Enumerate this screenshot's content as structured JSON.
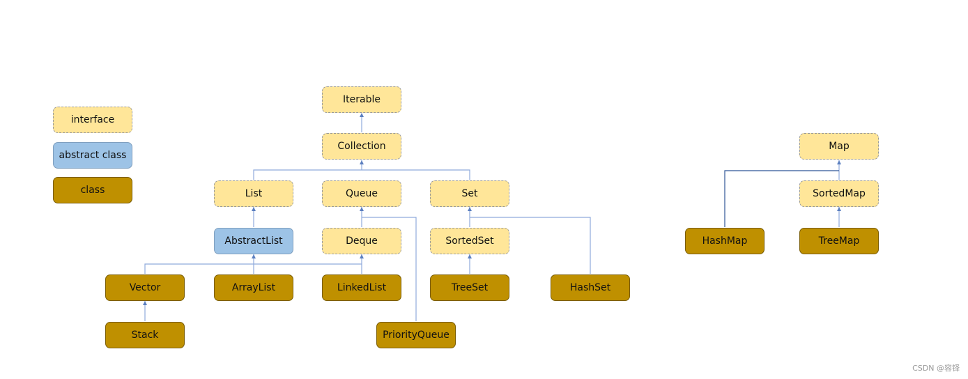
{
  "colors": {
    "interface": "#ffe699",
    "abstract_class": "#9dc3e6",
    "class": "#bf9000",
    "edge": "#5b7fbf"
  },
  "legend": {
    "interface": "interface",
    "abstract_class": "abstract class",
    "class": "class"
  },
  "nodes": {
    "iterable": "Iterable",
    "collection": "Collection",
    "list": "List",
    "queue": "Queue",
    "set": "Set",
    "abstractlist": "AbstractList",
    "deque": "Deque",
    "sortedset": "SortedSet",
    "vector": "Vector",
    "arraylist": "ArrayList",
    "linkedlist": "LinkedList",
    "treeset": "TreeSet",
    "hashset": "HashSet",
    "stack": "Stack",
    "priorityqueue": "PriorityQueue",
    "map": "Map",
    "sortedmap": "SortedMap",
    "hashmap": "HashMap",
    "treemap": "TreeMap"
  },
  "watermark": "CSDN @容铎"
}
